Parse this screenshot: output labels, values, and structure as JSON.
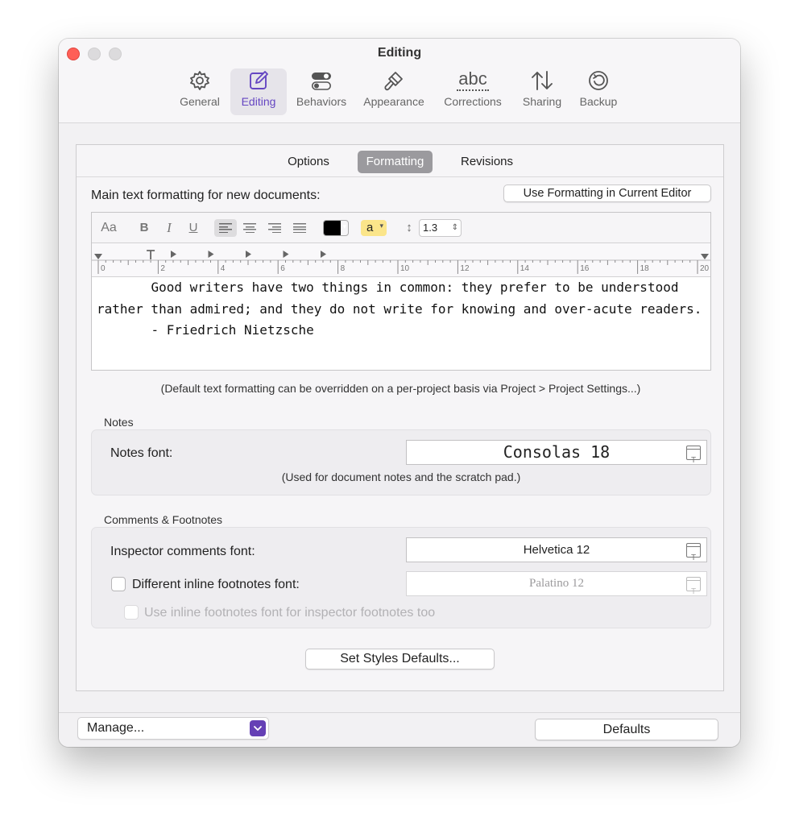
{
  "window": {
    "title": "Editing"
  },
  "toolbar": {
    "items": [
      {
        "label": "General",
        "icon": "gear-icon"
      },
      {
        "label": "Editing",
        "icon": "edit-icon",
        "selected": true
      },
      {
        "label": "Behaviors",
        "icon": "toggles-icon"
      },
      {
        "label": "Appearance",
        "icon": "paintbrush-icon"
      },
      {
        "label": "Corrections",
        "icon": "abc-icon",
        "icon_text": "abc"
      },
      {
        "label": "Sharing",
        "icon": "arrows-up-down-icon"
      },
      {
        "label": "Backup",
        "icon": "backup-clock-icon"
      }
    ]
  },
  "tabs": {
    "options": "Options",
    "formatting": "Formatting",
    "revisions": "Revisions",
    "active": "Formatting"
  },
  "formatting": {
    "label": "Main text formatting for new documents:",
    "use_current_button": "Use Formatting in Current Editor",
    "bar": {
      "font_button": "Aa",
      "bold": "B",
      "italic": "I",
      "underline": "U",
      "text_color": "#000000",
      "highlight_label": "a",
      "highlight_color": "#fbe58a",
      "line_spacing": "1.3",
      "selected_alignment": "left"
    },
    "ruler_numbers": [
      "0",
      "2",
      "4",
      "6",
      "8",
      "10",
      "12",
      "14",
      "16",
      "18",
      "20"
    ],
    "sample_text": "       Good writers have two things in common: they prefer to be understood rather than admired; and they do not write for knowing and over-acute readers.\n       - Friedrich Nietzsche",
    "note": "(Default text formatting can be overridden on a per-project basis via Project > Project Settings...)"
  },
  "notes": {
    "section_title": "Notes",
    "font_label": "Notes font:",
    "font_value": "Consolas 18",
    "note": "(Used for document notes and the scratch pad.)"
  },
  "comments": {
    "section_title": "Comments & Footnotes",
    "inspector_label": "Inspector comments font:",
    "inspector_value": "Helvetica 12",
    "inline_label": "Different inline footnotes font:",
    "inline_checked": false,
    "inline_value": "Palatino 12",
    "use_inline_label": "Use inline footnotes font for inspector footnotes too",
    "use_inline_checked": false
  },
  "styles_button": "Set Styles Defaults...",
  "footer": {
    "manage": "Manage...",
    "defaults": "Defaults"
  },
  "colors": {
    "accent": "#6546c2",
    "close": "#fe5f57"
  }
}
